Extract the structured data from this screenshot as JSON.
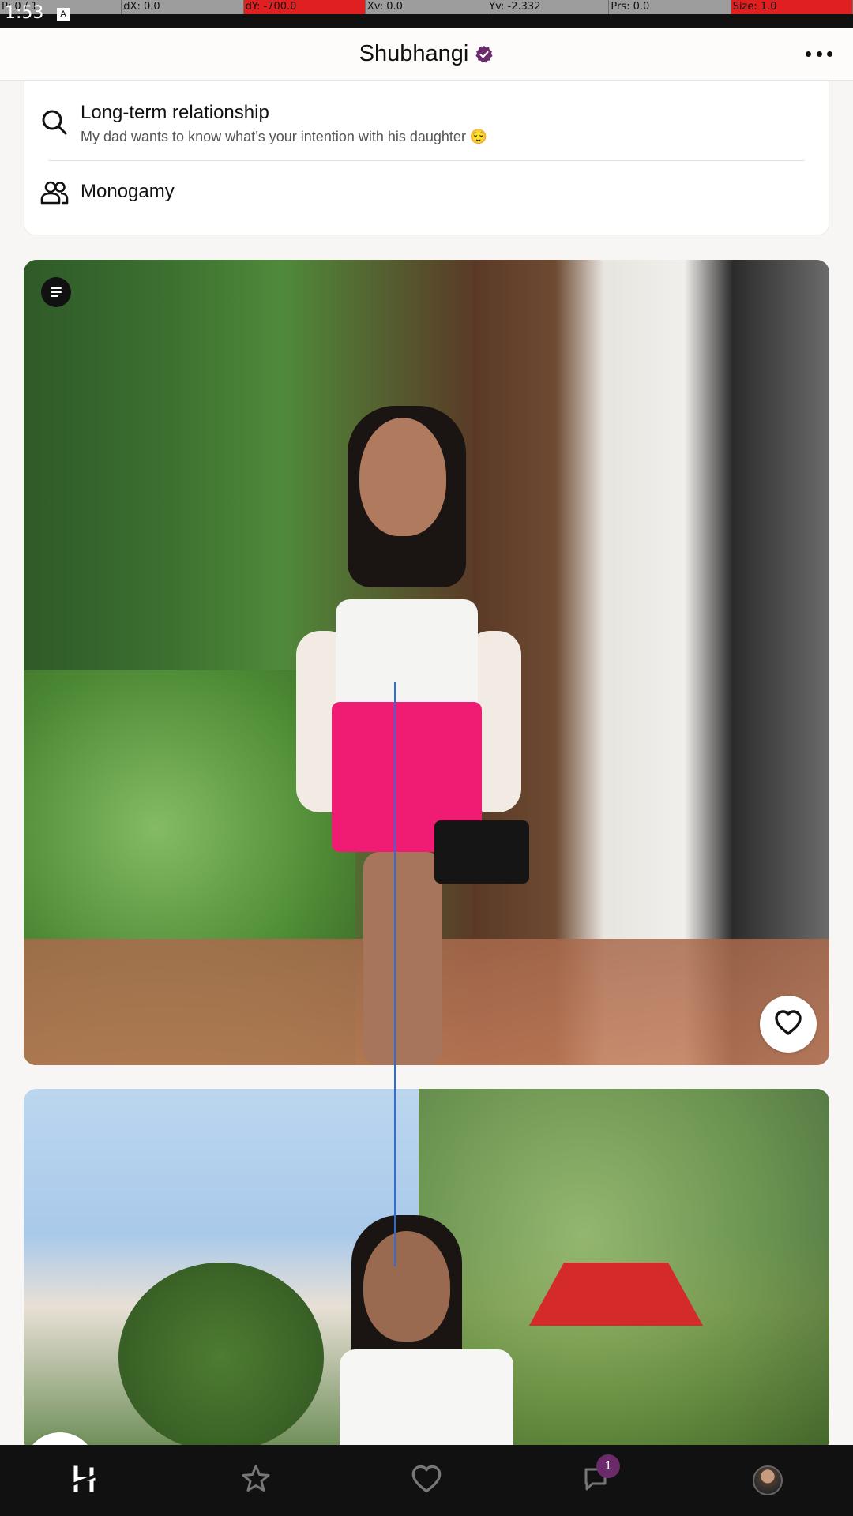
{
  "debug_bar": {
    "cells": [
      "P: 0 / 1",
      "dX: 0.0",
      "dY: -700.0",
      "Xv: 0.0",
      "Yv: -2.332",
      "Prs: 0.0",
      "Size: 1.0"
    ]
  },
  "status_bar": {
    "time": "1:53",
    "badge": "A"
  },
  "header": {
    "title": "Shubhangi",
    "verified_color": "#6b2a6a"
  },
  "profile": {
    "info_rows": [
      {
        "icon": "search-icon",
        "title": "Long-term relationship",
        "subtitle": "My dad wants to know what’s your intention with his daughter 😌"
      },
      {
        "icon": "people-icon",
        "title": "Monogamy"
      }
    ]
  },
  "photos": [
    {
      "name": "photo-1",
      "has_like": true
    },
    {
      "name": "photo-2",
      "has_like": false
    }
  ],
  "bottom_nav": {
    "items": [
      {
        "icon": "hinge-logo-icon"
      },
      {
        "icon": "star-icon"
      },
      {
        "icon": "heart-icon"
      },
      {
        "icon": "chat-icon",
        "badge": "1"
      },
      {
        "icon": "avatar"
      }
    ],
    "badge_color": "#6b2a6a"
  }
}
